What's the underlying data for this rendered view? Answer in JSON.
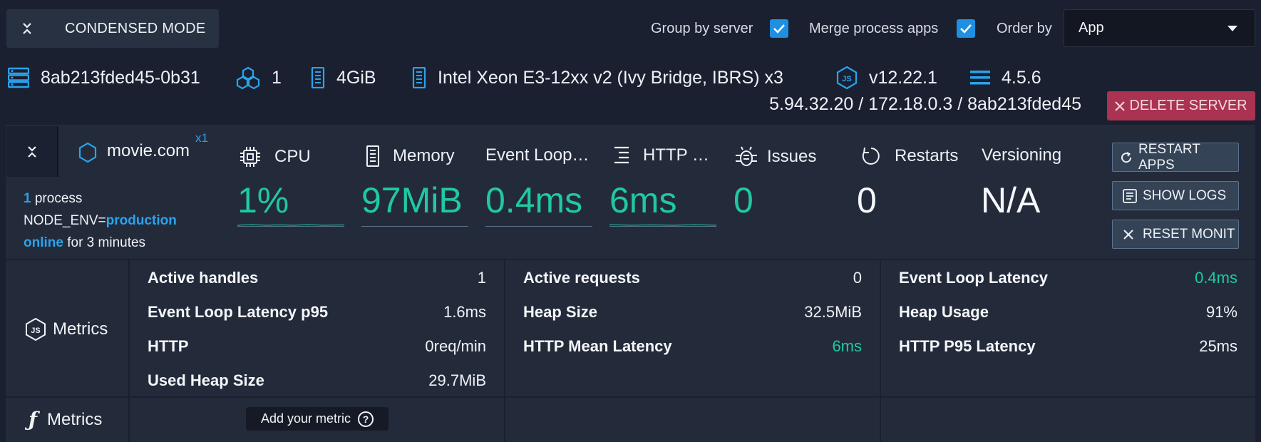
{
  "toolbar": {
    "condensed_label": "CONDENSED MODE",
    "group_by_server_label": "Group by server",
    "group_by_server_checked": true,
    "merge_process_label": "Merge process apps",
    "merge_process_checked": true,
    "order_by_label": "Order by",
    "order_by_value": "App"
  },
  "server": {
    "name": "8ab213fded45-0b31",
    "cpus": "1",
    "memory": "4GiB",
    "cpu_model": "Intel Xeon E3-12xx v2 (Ivy Bridge, IBRS) x3",
    "node_version": "v12.22.1",
    "agent_version": "4.5.6",
    "addresses": "5.94.32.20 / 172.18.0.3 / 8ab213fded45",
    "delete_label": "DELETE SERVER"
  },
  "app": {
    "name": "movie.com",
    "instances": "x1",
    "process_count": "1",
    "process_word": " process",
    "env_key": "NODE_ENV=",
    "env_value": "production",
    "status": "online",
    "uptime": " for 3 minutes",
    "metrics": [
      {
        "label": "CPU",
        "value": "1%",
        "icon": "chip-icon"
      },
      {
        "label": "Memory",
        "value": "97MiB",
        "icon": "memory-icon"
      },
      {
        "label": "Event Loop…",
        "value": "0.4ms",
        "icon": ""
      },
      {
        "label": "HTTP …",
        "value": "6ms",
        "icon": "http-icon"
      },
      {
        "label": "Issues",
        "value": "0",
        "icon": "bug-icon"
      },
      {
        "label": "Restarts",
        "value": "0",
        "icon": "restart-icon"
      },
      {
        "label": "Versioning",
        "value": "N/A",
        "icon": ""
      }
    ],
    "actions": {
      "restart": "RESTART APPS",
      "logs": "SHOW LOGS",
      "reset": "RESET MONIT"
    }
  },
  "node_metrics": {
    "label": "Metrics",
    "col1": [
      {
        "k": "Active handles",
        "v": "1"
      },
      {
        "k": "Event Loop Latency p95",
        "v": "1.6ms"
      },
      {
        "k": "HTTP",
        "v": "0req/min"
      },
      {
        "k": "Used Heap Size",
        "v": "29.7MiB"
      }
    ],
    "col2": [
      {
        "k": "Active requests",
        "v": "0"
      },
      {
        "k": "Heap Size",
        "v": "32.5MiB"
      },
      {
        "k": "HTTP Mean Latency",
        "v": "6ms"
      }
    ],
    "col3": [
      {
        "k": "Event Loop Latency",
        "v": "0.4ms"
      },
      {
        "k": "Heap Usage",
        "v": "91%"
      },
      {
        "k": "HTTP P95 Latency",
        "v": "25ms"
      }
    ]
  },
  "custom_metrics": {
    "label": "Metrics",
    "add_label": "Add your metric",
    "help_glyph": "?"
  },
  "colors": {
    "accent_blue": "#1e8fe1",
    "accent_green": "#1fc9a3",
    "danger": "#a93350"
  }
}
